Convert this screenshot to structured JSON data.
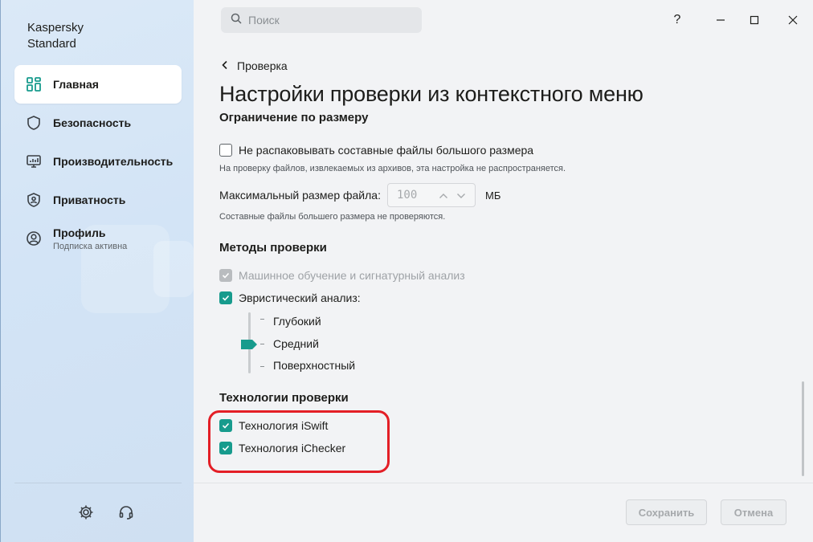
{
  "app": {
    "title_line1": "Kaspersky",
    "title_line2": "Standard"
  },
  "sidebar": {
    "items": [
      {
        "label": "Главная",
        "icon": "grid-icon",
        "active": true
      },
      {
        "label": "Безопасность",
        "icon": "shield-icon"
      },
      {
        "label": "Производительность",
        "icon": "monitor-icon"
      },
      {
        "label": "Приватность",
        "icon": "privacy-shield-icon"
      },
      {
        "label": "Профиль",
        "sub": "Подписка активна",
        "icon": "user-icon"
      }
    ],
    "bottom_icons": [
      "gear-icon",
      "headset-icon"
    ]
  },
  "search": {
    "placeholder": "Поиск"
  },
  "window_controls": {
    "help": "?",
    "minimize": "—",
    "maximize": "☐",
    "close": "✕"
  },
  "breadcrumb": {
    "back_label": "Проверка"
  },
  "page_title": "Настройки проверки из контекстного меню",
  "size_limit": {
    "heading": "Ограничение по размеру",
    "checkbox_label": "Не распаковывать составные файлы большого размера",
    "checkbox_checked": false,
    "hint1": "На проверку файлов, извлекаемых из архивов, эта настройка не распространяется.",
    "field_label": "Максимальный размер файла:",
    "field_value": "100",
    "unit": "МБ",
    "hint2": "Составные файлы большего размера не проверяются."
  },
  "methods": {
    "heading": "Методы проверки",
    "ml_label": "Машинное обучение и сигнатурный анализ",
    "heuristic_label": "Эвристический анализ:",
    "levels": [
      "Глубокий",
      "Средний",
      "Поверхностный"
    ],
    "selected_level": "Средний"
  },
  "technologies": {
    "heading": "Технологии проверки",
    "items": [
      {
        "label": "Технология iSwift",
        "checked": true
      },
      {
        "label": "Технология iChecker",
        "checked": true
      }
    ]
  },
  "footer": {
    "save_label": "Сохранить",
    "cancel_label": "Отмена"
  },
  "colors": {
    "accent": "#179b8d",
    "highlight": "#e31e26"
  }
}
